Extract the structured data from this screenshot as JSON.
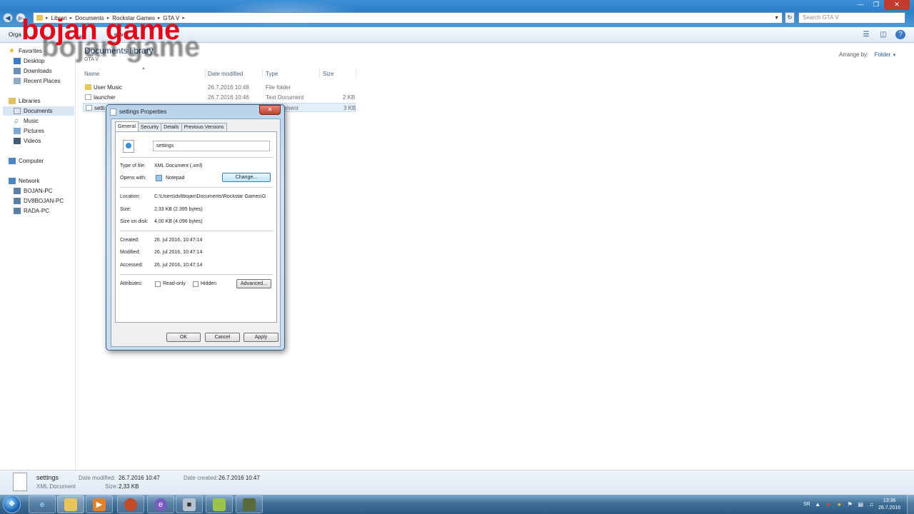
{
  "watermark": "bojan game",
  "address": {
    "crumbs": [
      "Librari",
      "Documents",
      "Rockstar Games",
      "GTA V"
    ],
    "search_placeholder": "Search GTA V"
  },
  "commands": {
    "organize": "Orga",
    "share": "p",
    "view": "e w"
  },
  "nav": {
    "favorites": "Favorites",
    "desktop": "Desktop",
    "downloads": "Downloads",
    "recent": "Recent Places",
    "libraries": "Libraries",
    "documents": "Documents",
    "music": "Music",
    "pictures": "Pictures",
    "videos": "Videos",
    "computer": "Computer",
    "network": "Network",
    "pc1": "BOJAN-PC",
    "pc2": "DV8BOJAN-PC",
    "pc3": "RADA-PC"
  },
  "library": {
    "title": "Documents library",
    "subtitle": "GTA V",
    "arrange_label": "Arrange by:",
    "arrange_value": "Folder"
  },
  "columns": {
    "name": "Name",
    "date": "Date modified",
    "type": "Type",
    "size": "Size"
  },
  "files": [
    {
      "name": "User Music",
      "date": "26.7.2016 10:48",
      "type": "File folder",
      "size": ""
    },
    {
      "name": "launcher",
      "date": "26.7.2016 10:46",
      "type": "Text Document",
      "size": "2 KB"
    },
    {
      "name": "setti",
      "date": "",
      "type": "ocument",
      "size": "3 KB"
    }
  ],
  "details": {
    "name": "settings",
    "kind": "XML Document",
    "modified_label": "Date modified:",
    "modified": "26.7.2016 10:47",
    "size_label": "Size:",
    "size": "2,33 KB",
    "created_label": "Date created:",
    "created": "26.7.2016 10:47"
  },
  "dialog": {
    "title": "settings Properties",
    "tabs": [
      "General",
      "Security",
      "Details",
      "Previous Versions"
    ],
    "filename": "settings",
    "type_label": "Type of file:",
    "type_value": "XML Document (.xml)",
    "opens_label": "Opens with:",
    "opens_value": "Notepad",
    "change_button": "Change...",
    "location_label": "Location:",
    "location_value": "C:\\Users\\dv8bojan\\Documents\\Rockstar Games\\G",
    "size_label": "Size:",
    "size_value": "2,33 KB (2.395 bytes)",
    "disk_label": "Size on disk:",
    "disk_value": "4,00 KB (4.096 bytes)",
    "created_label": "Created:",
    "created_value": "26. jul 2016, 10:47:14",
    "modified_label": "Modified:",
    "modified_value": "26. jul 2016, 10:47:14",
    "accessed_label": "Accessed:",
    "accessed_value": "26. jul 2016, 10:47:14",
    "attributes_label": "Attributes:",
    "readonly_label": "Read-only",
    "hidden_label": "Hidden",
    "advanced_button": "Advanced...",
    "ok_button": "OK",
    "cancel_button": "Cancel",
    "apply_button": "Apply"
  },
  "tray": {
    "lang": "SR",
    "time": "13:36",
    "date": "26.7.2016"
  },
  "colors": {
    "watermark": "#e3061a",
    "titlebar": "#3d8fd6",
    "taskbar": "#3f6f98"
  }
}
